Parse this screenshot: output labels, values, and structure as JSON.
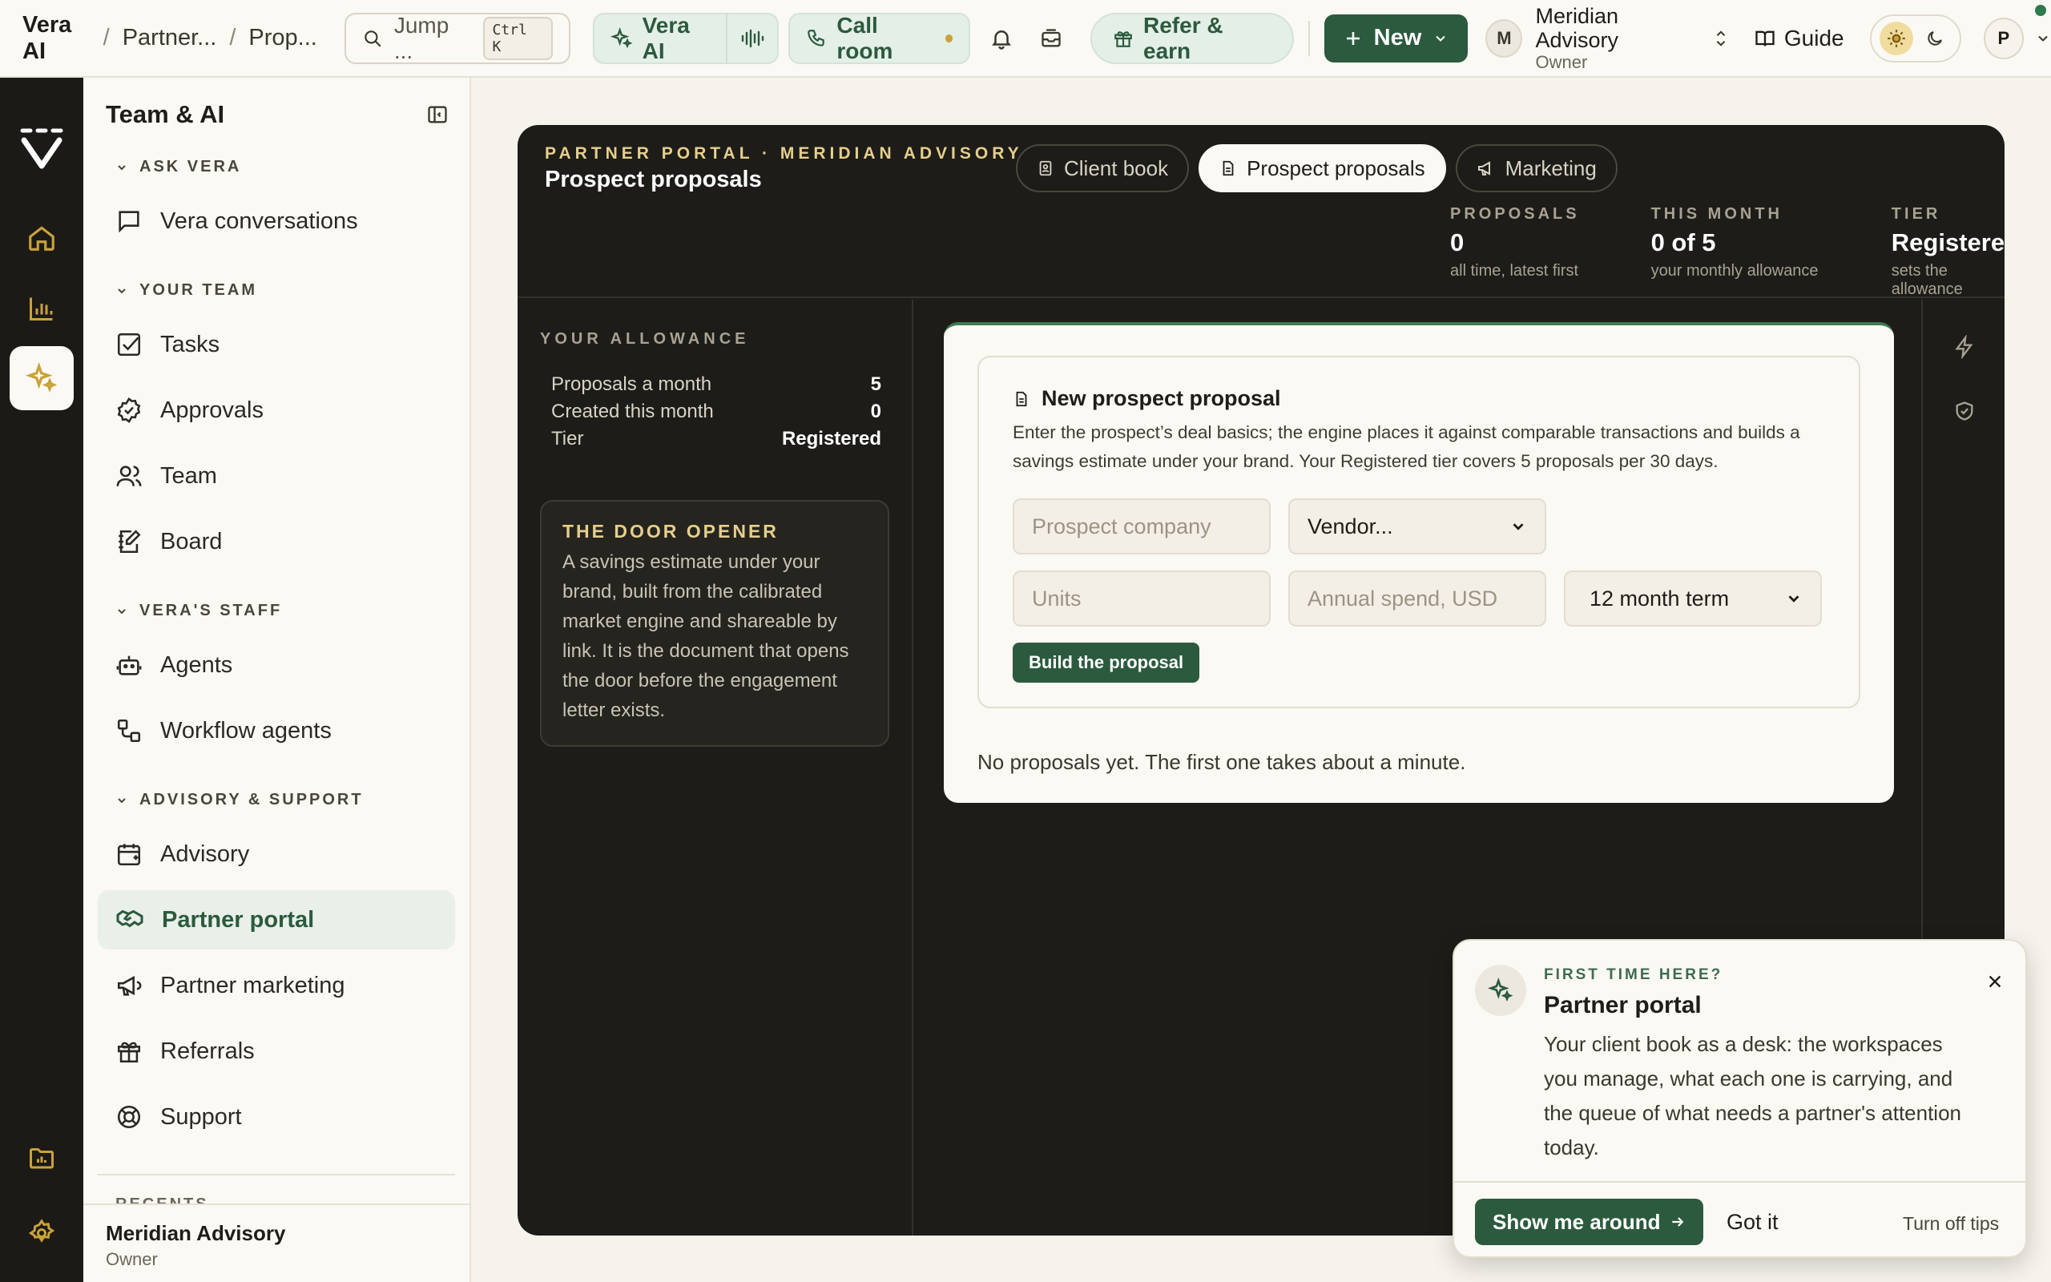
{
  "topbar": {
    "breadcrumb": [
      "Vera AI",
      "Partner...",
      "Prop..."
    ],
    "search_placeholder": "Jump ...",
    "search_shortcut": "Ctrl K",
    "vera_ai_label": "Vera AI",
    "call_room_label": "Call room",
    "refer_label": "Refer & earn",
    "new_label": "New",
    "account_initial": "M",
    "account_name": "Meridian Advisory",
    "account_role": "Owner",
    "guide_label": "Guide",
    "profile_initial": "P"
  },
  "sidebar": {
    "title": "Team & AI",
    "sections": {
      "ask_vera": "ASK VERA",
      "your_team": "YOUR TEAM",
      "veras_staff": "VERA'S STAFF",
      "advisory_support": "ADVISORY & SUPPORT",
      "recents": "RECENTS"
    },
    "items": {
      "conversations": "Vera conversations",
      "tasks": "Tasks",
      "approvals": "Approvals",
      "team": "Team",
      "board": "Board",
      "agents": "Agents",
      "workflow": "Workflow agents",
      "advisory": "Advisory",
      "partner_portal": "Partner portal",
      "partner_marketing": "Partner marketing",
      "referrals": "Referrals",
      "support": "Support"
    },
    "footer_name": "Meridian Advisory",
    "footer_role": "Owner"
  },
  "portal": {
    "eyebrow": "PARTNER PORTAL · MERIDIAN ADVISORY",
    "title": "Prospect proposals",
    "tabs": [
      "Client book",
      "Prospect proposals",
      "Marketing"
    ],
    "stats": [
      {
        "label": "PROPOSALS",
        "value": "0",
        "sub": "all time, latest first"
      },
      {
        "label": "THIS MONTH",
        "value": "0 of 5",
        "sub": "your monthly allowance"
      },
      {
        "label": "TIER",
        "value": "Registered",
        "sub": "sets the allowance"
      }
    ],
    "allowance": {
      "heading": "YOUR ALLOWANCE",
      "rows": [
        {
          "label": "Proposals a month",
          "value": "5"
        },
        {
          "label": "Created this month",
          "value": "0"
        },
        {
          "label": "Tier",
          "value": "Registered"
        }
      ]
    },
    "door": {
      "title": "THE DOOR OPENER",
      "body": "A savings estimate under your brand, built from the calibrated market engine and shareable by link. It is the document that opens the door before the engagement letter exists."
    },
    "form": {
      "title": "New prospect proposal",
      "description": "Enter the prospect’s deal basics; the engine places it against comparable transactions and builds a savings estimate under your brand. Your Registered tier covers 5 proposals per 30 days.",
      "company_placeholder": "Prospect company",
      "vendor_value": "Vendor...",
      "units_placeholder": "Units",
      "spend_placeholder": "Annual spend, USD",
      "term_value": "12 month term",
      "submit_label": "Build the proposal"
    },
    "empty_text": "No proposals yet. The first one takes about a minute."
  },
  "tip": {
    "eyebrow": "FIRST TIME HERE?",
    "title": "Partner portal",
    "body": "Your client book as a desk: the workspaces you manage, what each one is carrying, and the queue of what needs a partner's attention today.",
    "primary": "Show me around",
    "secondary": "Got it",
    "tertiary": "Turn off tips"
  },
  "colors": {
    "accent": "#2c5a3e",
    "dark_panel": "#1d1c18",
    "gold": "#e6cf8c"
  }
}
